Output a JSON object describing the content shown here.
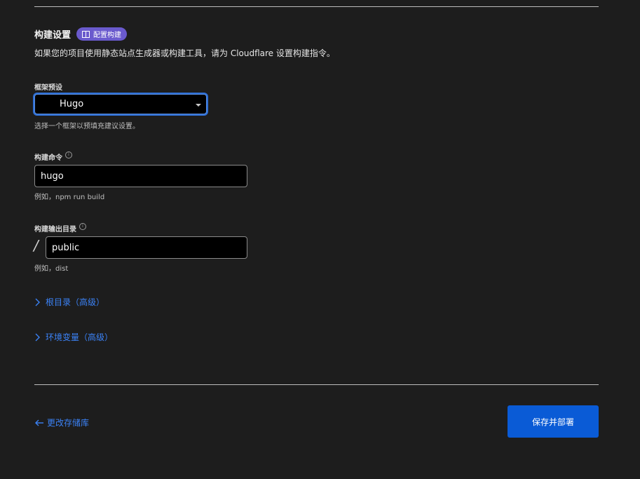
{
  "build": {
    "title": "构建设置",
    "badge_label": "配置构建",
    "description": "如果您的项目使用静态站点生成器或构建工具，请为 Cloudflare 设置构建指令。"
  },
  "framework": {
    "label": "框架预设",
    "selected": "Hugo",
    "help": "选择一个框架以预填充建议设置。"
  },
  "command": {
    "label": "构建命令",
    "value": "hugo",
    "help": "例如，npm run build"
  },
  "output": {
    "label": "构建输出目录",
    "prefix": "/",
    "value": "public",
    "help": "例如，dist"
  },
  "advanced": {
    "root_label": "根目录（高级）",
    "env_label": "环境变量（高级）"
  },
  "footer": {
    "back_label": "更改存储库",
    "save_label": "保存并部署"
  },
  "colors": {
    "accent": "#3b82f6",
    "primary_button": "#0a5bd6",
    "badge": "#6a5acd"
  }
}
